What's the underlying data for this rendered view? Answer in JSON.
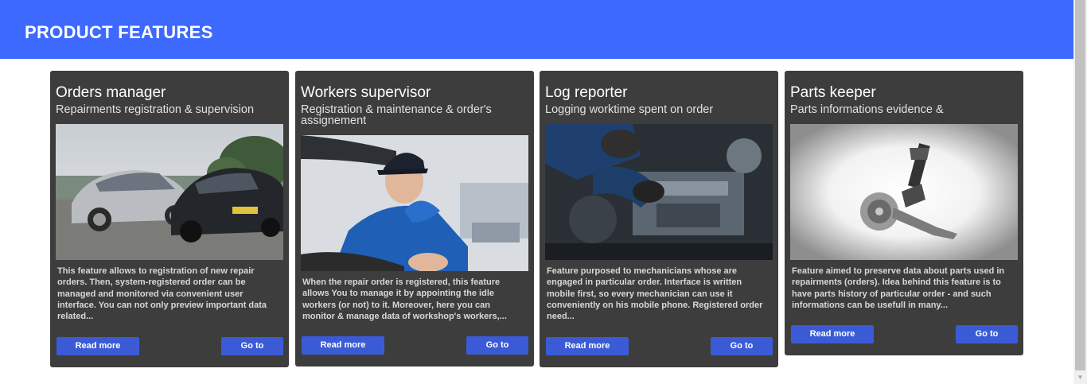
{
  "header": {
    "title": "PRODUCT FEATURES"
  },
  "colors": {
    "header_bg": "#3d69fe",
    "card_bg": "#3d3d3d",
    "button_bg": "#3b5bd6"
  },
  "cards": [
    {
      "title": "Orders manager",
      "subtitle": "Repairments registration & supervision",
      "image": "cars-photo",
      "description": "This feature allows to registration of new repair orders. Then, system-registered order can be managed and monitored via convenient user interface. You can not only preview important data related...",
      "read_more": "Read more",
      "go_to": "Go to"
    },
    {
      "title": "Workers supervisor",
      "subtitle": "Registration & maintenance & order's assignement",
      "image": "mechanic-photo",
      "description": "When the repair order is registered, this feature allows You to manage it by appointing the idle workers (or not) to it. Moreover, here you can monitor & manage data of workshop's workers,...",
      "read_more": "Read more",
      "go_to": "Go to"
    },
    {
      "title": "Log reporter",
      "subtitle": "Logging worktime spent on order",
      "image": "engine-photo",
      "description": "Feature purposed to mechanicians whose are engaged in particular order. Interface is written mobile first, so every mechanician can use it conveniently on his mobile phone. Registered order need...",
      "read_more": "Read more",
      "go_to": "Go to"
    },
    {
      "title": "Parts keeper",
      "subtitle": "Parts informations evidence &",
      "image": "suspension-part-photo",
      "description": "Feature aimed to preserve data about parts used in repairments (orders). Idea behind this feature is to have parts history of particular order - and such informations can be usefull in many...",
      "read_more": "Read more",
      "go_to": "Go to"
    }
  ]
}
